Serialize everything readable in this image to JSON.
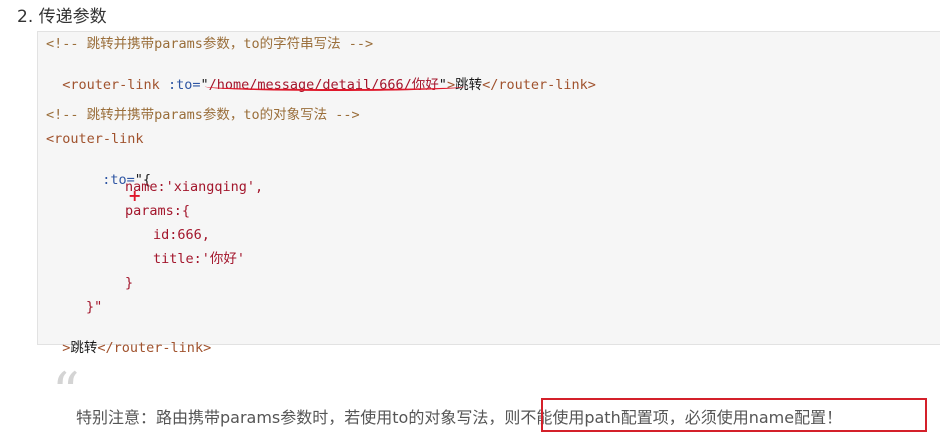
{
  "heading": "2. 传递参数",
  "code": {
    "comment1": "<!-- 跳转并携带params参数，to的字符串写法 -->",
    "line2": {
      "open": "<router-link",
      "attr": " :to=",
      "q1": "\"",
      "value": "/home/message/detail/666/你好",
      "q2": "\"",
      "gt": ">",
      "text": "跳转",
      "close": "</router-link>"
    },
    "comment2": "<!-- 跳转并携带params参数，to的对象写法 -->",
    "open_tag": "<router-link",
    "to_attr": ":to=",
    "to_open": "\"{",
    "name_line": "name:'xiangqing',",
    "params_line": "params:{",
    "id_line": "id:666,",
    "title_line": "title:'你好'",
    "inner_close": "}",
    "outer_close": "}\"",
    "final": {
      "gt": ">",
      "text": "跳转",
      "close": "</router-link>"
    }
  },
  "note": {
    "prefix": "特别注意：路由携带params参数时，若使用to的对象写法，",
    "highlight": "则不能使用path配置项，必须使用name配置！"
  },
  "colors": {
    "annotation_red": "#e0172a",
    "comment": "#9a6e3a",
    "tag": "#a0522d",
    "string": "#a3162c"
  }
}
